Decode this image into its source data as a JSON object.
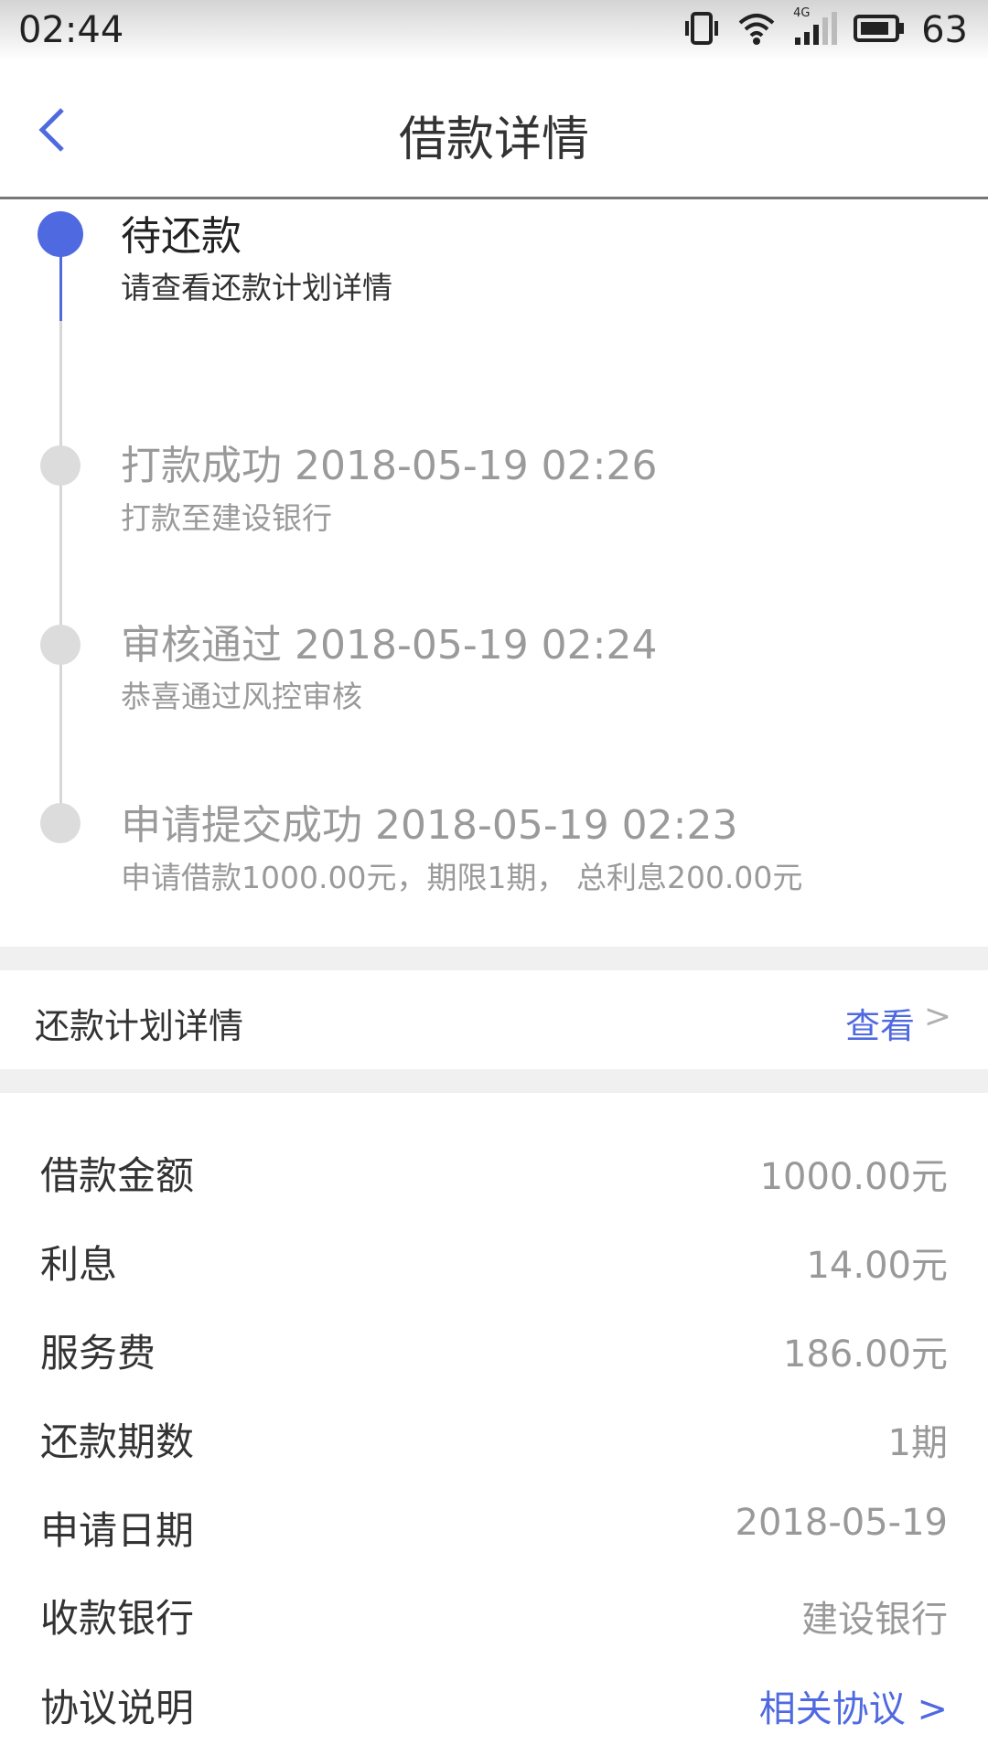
{
  "status_bar": {
    "time": "02:44",
    "network": "4G",
    "battery": "63",
    "icons": [
      "vibrate-icon",
      "wifi-icon",
      "signal-icon",
      "battery-icon"
    ]
  },
  "header": {
    "title": "借款详情",
    "back_icon": "chevron-left-icon"
  },
  "timeline": [
    {
      "title": "待还款",
      "subtitle": "请查看还款计划详情",
      "active": true
    },
    {
      "title": "打款成功 2018-05-19 02:26",
      "subtitle": "打款至建设银行",
      "active": false
    },
    {
      "title": "审核通过 2018-05-19 02:24",
      "subtitle": "恭喜通过风控审核",
      "active": false
    },
    {
      "title": "申请提交成功 2018-05-19 02:23",
      "subtitle": "申请借款1000.00元，期限1期， 总利息200.00元",
      "active": false
    }
  ],
  "plan": {
    "label": "还款计划详情",
    "link": "查看",
    "arrow": ">"
  },
  "details": [
    {
      "label": "借款金额",
      "value": "1000.00元"
    },
    {
      "label": "利息",
      "value": "14.00元"
    },
    {
      "label": "服务费",
      "value": "186.00元"
    },
    {
      "label": "还款期数",
      "value": "1期"
    },
    {
      "label": "申请日期",
      "value": "2018-05-19"
    },
    {
      "label": "收款银行",
      "value": "建设银行"
    },
    {
      "label": "协议说明",
      "value": "相关协议 >"
    }
  ],
  "colors": {
    "accent": "#4f6ae0",
    "muted": "#9a9a9a",
    "divider": "#f0f0f0"
  }
}
